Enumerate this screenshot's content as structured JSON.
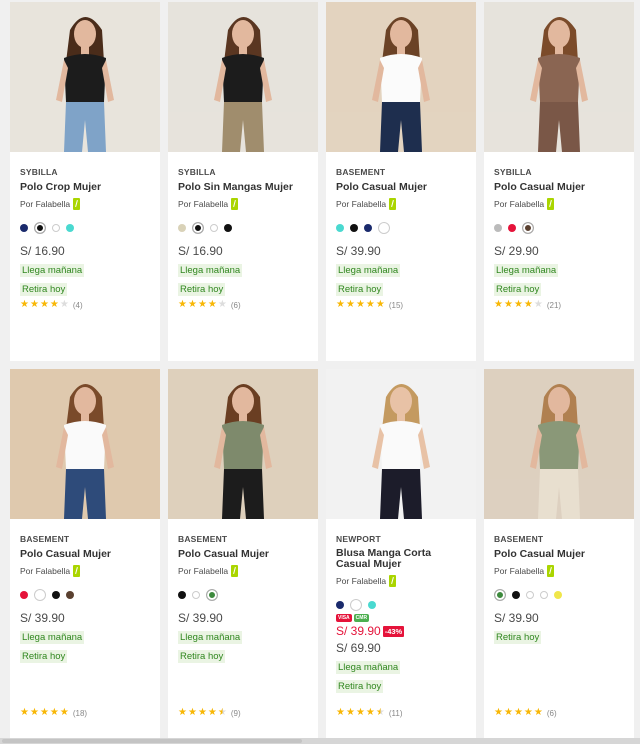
{
  "products": [
    {
      "brand": "SYBILLA",
      "name": "Polo Crop Mujer",
      "seller": "Por Falabella",
      "swatches": [
        "#1a2a6c",
        "#111111",
        "#ffffff",
        "#4ad9d0"
      ],
      "selected_swatch": 1,
      "price": "S/ 16.90",
      "tags": [
        "Llega mañana",
        "Retira hoy"
      ],
      "rating": 4,
      "reviews": "(4)",
      "image": {
        "bg": "#e8e4dc",
        "top": "#1c1c1c",
        "bottom": "#7fa3c8",
        "skin": "#e2b89e",
        "hair": "#4a2c1a"
      }
    },
    {
      "brand": "SYBILLA",
      "name": "Polo Sin Mangas Mujer",
      "seller": "Por Falabella",
      "swatches": [
        "#d9d2b8",
        "#111111",
        "#ffffff",
        "#111111"
      ],
      "selected_swatch": 1,
      "price": "S/ 16.90",
      "tags": [
        "Llega mañana",
        "Retira hoy"
      ],
      "rating": 4,
      "reviews": "(6)",
      "image": {
        "bg": "#e6e3dc",
        "top": "#1c1c1c",
        "bottom": "#a08d6d",
        "skin": "#e2b89e",
        "hair": "#5a3621"
      }
    },
    {
      "brand": "BASEMENT",
      "name": "Polo Casual Mujer",
      "seller": "Por Falabella",
      "swatches": [
        "#4ad9d0",
        "#111111",
        "#1a2a6c",
        "#ffffff"
      ],
      "selected_swatch": 3,
      "price": "S/ 39.90",
      "tags": [
        "Llega mañana",
        "Retira hoy"
      ],
      "rating": 5,
      "reviews": "(15)",
      "image": {
        "bg": "#e3d3bf",
        "top": "#fbfbfb",
        "bottom": "#1e2e4e",
        "skin": "#e2b89e",
        "hair": "#6b4226"
      }
    },
    {
      "brand": "SYBILLA",
      "name": "Polo Casual Mujer",
      "seller": "Por Falabella",
      "swatches": [
        "#bbbbbb",
        "#e5133a",
        "#5a4030"
      ],
      "selected_swatch": 2,
      "price": "S/ 29.90",
      "tags": [
        "Llega mañana",
        "Retira hoy"
      ],
      "rating": 4,
      "reviews": "(21)",
      "image": {
        "bg": "#e6e3dc",
        "top": "#8a6552",
        "bottom": "#7a5747",
        "skin": "#e2b89e",
        "hair": "#7b4b2a"
      }
    },
    {
      "brand": "BASEMENT",
      "name": "Polo Casual Mujer",
      "seller": "Por Falabella",
      "swatches": [
        "#e5133a",
        "#ffffff",
        "#111111",
        "#5a4030"
      ],
      "selected_swatch": 1,
      "price": "S/ 39.90",
      "tags": [
        "Llega mañana",
        "Retira hoy"
      ],
      "rating": 5,
      "reviews": "(18)",
      "image": {
        "bg": "#dfc9ae",
        "top": "#fafafa",
        "bottom": "#2e4b7a",
        "skin": "#e2b89e",
        "hair": "#7a4a2a"
      }
    },
    {
      "brand": "BASEMENT",
      "name": "Polo Casual Mujer",
      "seller": "Por Falabella",
      "swatches": [
        "#111111",
        "#ffffff",
        "#3c8a3c"
      ],
      "selected_swatch": 2,
      "price": "S/ 39.90",
      "tags": [
        "Llega mañana",
        "Retira hoy"
      ],
      "rating": 4.5,
      "reviews": "(9)",
      "image": {
        "bg": "#ded0bc",
        "top": "#7e8a6c",
        "bottom": "#1c1c1c",
        "skin": "#e2b89e",
        "hair": "#6a3e22"
      }
    },
    {
      "brand": "NEWPORT",
      "name": "Blusa Manga Corta Casual Mujer",
      "seller": "Por Falabella",
      "swatches": [
        "#1a2a6c",
        "#ffffff",
        "#4ad9d0"
      ],
      "selected_swatch": 1,
      "promo_badges": [
        "VISA",
        "CMR"
      ],
      "sale_price": "S/ 39.90",
      "discount": "-43%",
      "price": "S/ 69.90",
      "tags": [
        "Llega mañana",
        "Retira hoy"
      ],
      "rating": 4.5,
      "reviews": "(11)",
      "image": {
        "bg": "#f2f2f2",
        "top": "#fafafa",
        "bottom": "#1c1c2a",
        "skin": "#e8c2a6",
        "hair": "#c49a60"
      }
    },
    {
      "brand": "BASEMENT",
      "name": "Polo Casual Mujer",
      "seller": "Por Falabella",
      "swatches": [
        "#3c8a3c",
        "#111111",
        "#ffffff",
        "#ffffff",
        "#f0e64a"
      ],
      "selected_swatch": 0,
      "price": "S/ 39.90",
      "tags": [
        "Retira hoy"
      ],
      "rating": 5,
      "reviews": "(6)",
      "image": {
        "bg": "#ddd0bf",
        "top": "#8a9878",
        "bottom": "#e8dfcf",
        "skin": "#e2b89e",
        "hair": "#b08050"
      }
    }
  ],
  "colors": {
    "accent_green": "#30871f",
    "sale_red": "#e5133a",
    "star": "#f8b706"
  }
}
